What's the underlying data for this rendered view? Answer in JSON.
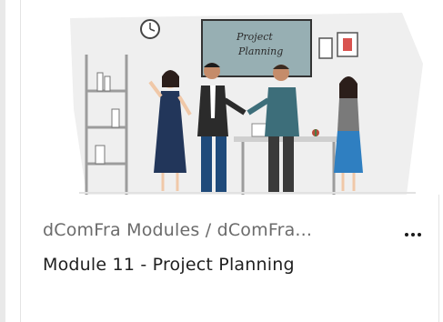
{
  "card": {
    "path": "dCom​Fra Modules / dCom​Fra...",
    "title": "Module 11 - Project Planning",
    "more_label": "More options",
    "thumbnail": {
      "board_line1": "Project",
      "board_line2": "Planning"
    }
  },
  "colors": {
    "accent_teal": "#3d6e7a",
    "board_green": "#4f7a82",
    "dress_navy": "#22365a",
    "skirt_blue": "#2f7fc1"
  }
}
